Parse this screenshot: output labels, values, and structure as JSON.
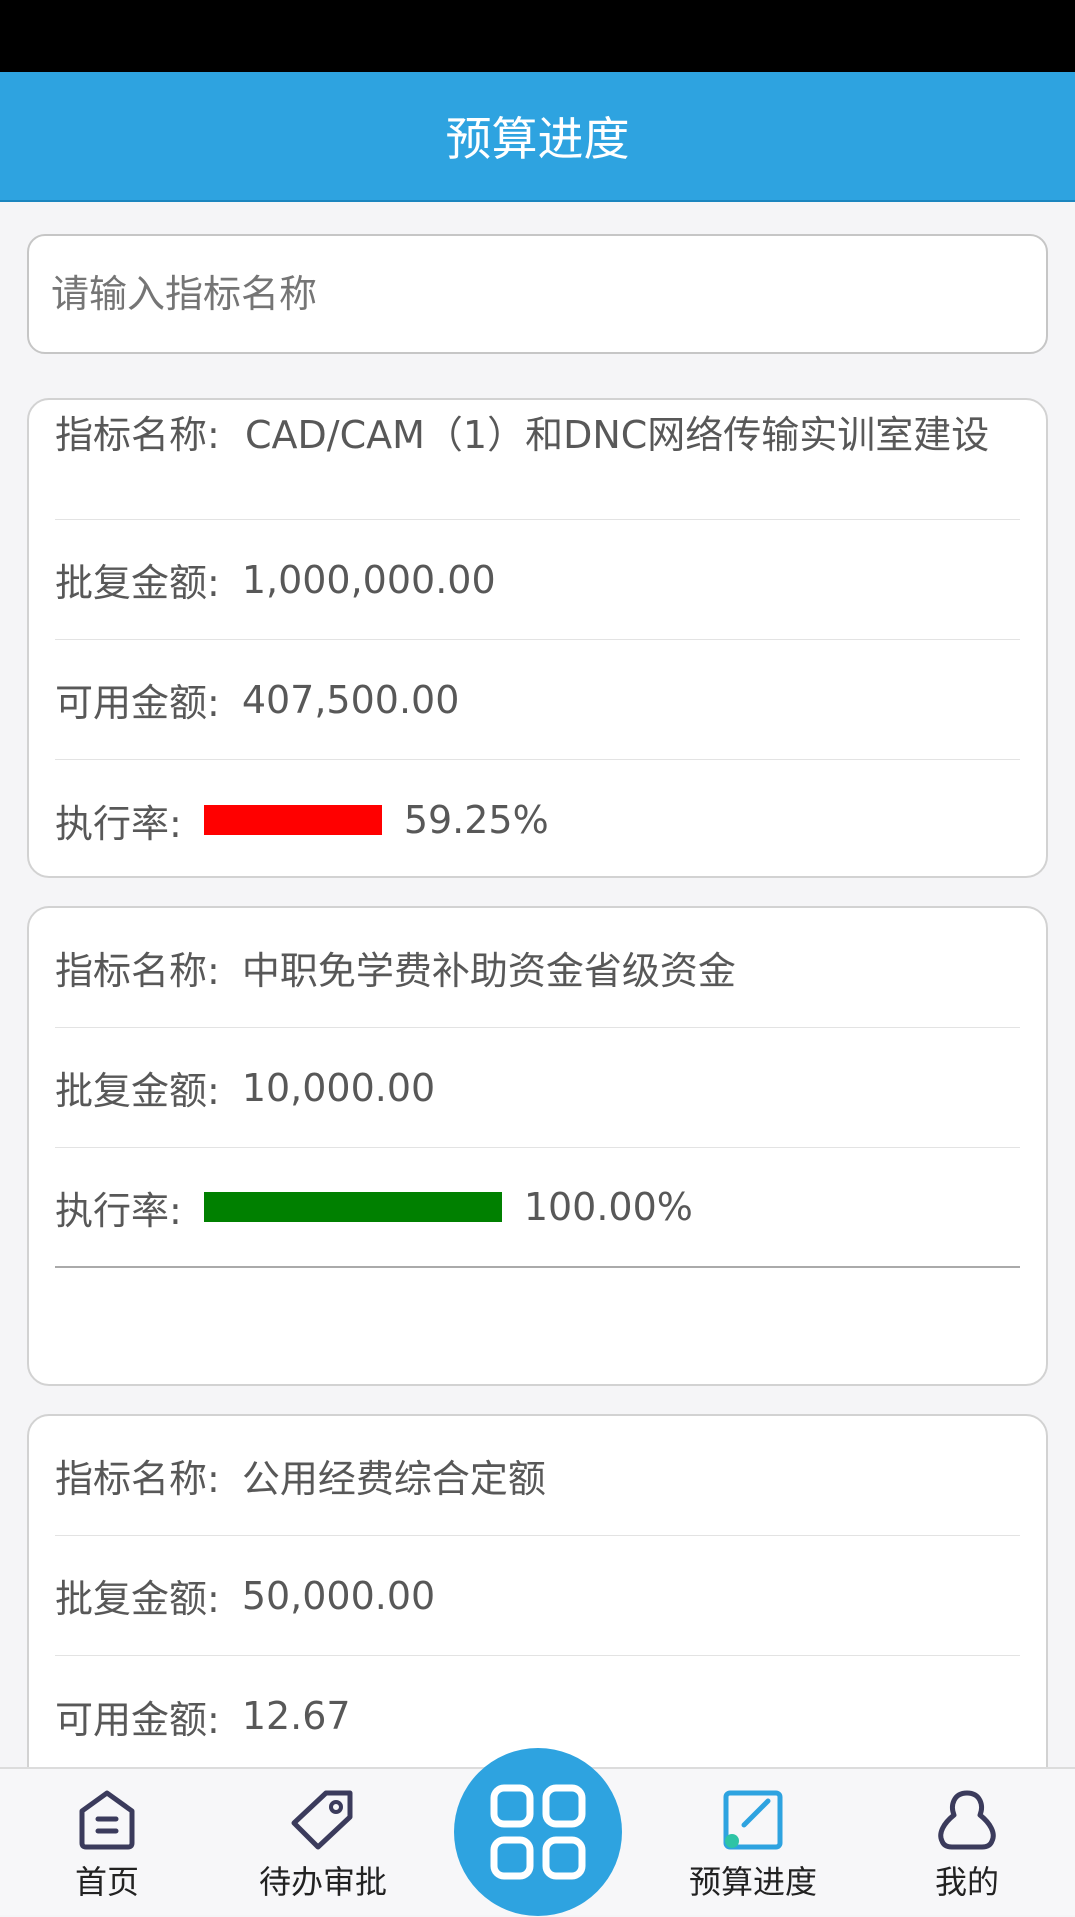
{
  "header": {
    "title": "预算进度"
  },
  "search": {
    "placeholder": "请输入指标名称"
  },
  "cards": [
    {
      "name_label": "指标名称:",
      "name_value": "CAD/CAM（1）和DNC网络传输实训室建设",
      "approved_label": "批复金额:",
      "approved_value": "1,000,000.00",
      "available_label": "可用金额:",
      "available_value": "407,500.00",
      "rate_label": "执行率:",
      "rate_value": "59.25%",
      "rate_fraction": 0.5925,
      "bar_color": "#ff0000"
    },
    {
      "name_label": "指标名称:",
      "name_value": "中职免学费补助资金省级资金",
      "approved_label": "批复金额:",
      "approved_value": "10,000.00",
      "rate_label": "执行率:",
      "rate_value": "100.00%",
      "rate_fraction": 1.0,
      "bar_color": "#008000"
    },
    {
      "name_label": "指标名称:",
      "name_value": "公用经费综合定额",
      "approved_label": "批复金额:",
      "approved_value": "50,000.00",
      "available_label": "可用金额:",
      "available_value": "12.67"
    }
  ],
  "nav": {
    "home": "首页",
    "pending": "待办审批",
    "budget": "预算进度",
    "mine": "我的"
  },
  "colors": {
    "accent": "#2ea3e0",
    "red": "#ff0000",
    "green": "#008000"
  }
}
